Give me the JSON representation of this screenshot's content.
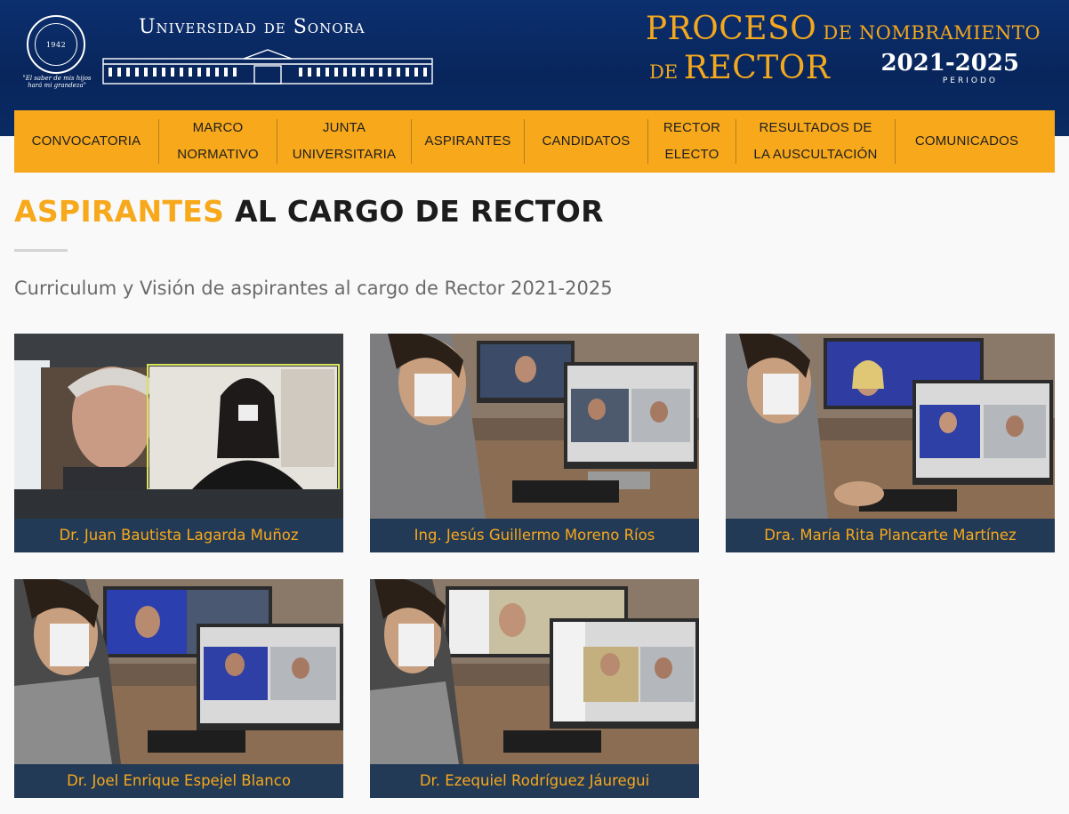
{
  "header": {
    "seal_text": "1942",
    "motto": "\"El saber de mis hijos hará mi grandeza\"",
    "university": "Universidad de Sonora",
    "title_line1_big": "PROCESO",
    "title_line1_small": " DE NOMBRAMIENTO",
    "title_line2_small": "DE ",
    "title_line2_big": "RECTOR",
    "years": "2021-2025",
    "periodo": "PERIODO"
  },
  "nav": {
    "items": [
      {
        "label_lines": [
          "CONVOCATORIA"
        ]
      },
      {
        "label_lines": [
          "MARCO",
          "NORMATIVO"
        ]
      },
      {
        "label_lines": [
          "JUNTA",
          "UNIVERSITARIA"
        ]
      },
      {
        "label_lines": [
          "ASPIRANTES"
        ]
      },
      {
        "label_lines": [
          "CANDIDATOS"
        ]
      },
      {
        "label_lines": [
          "RECTOR",
          "ELECTO"
        ]
      },
      {
        "label_lines": [
          "RESULTADOS DE",
          "LA AUSCULTACIÓN"
        ]
      },
      {
        "label_lines": [
          "COMUNICADOS"
        ]
      }
    ]
  },
  "page": {
    "title_accent": "ASPIRANTES",
    "title_rest": " AL CARGO DE RECTOR",
    "subtitle": "Curriculum y Visión de aspirantes al cargo de Rector 2021-2025"
  },
  "cards": [
    {
      "name": "Dr. Juan Bautista Lagarda Muñoz"
    },
    {
      "name": "Ing. Jesús Guillermo Moreno Ríos"
    },
    {
      "name": "Dra. María Rita Plancarte Martínez"
    },
    {
      "name": "Dr. Joel Enrique Espejel Blanco"
    },
    {
      "name": "Dr. Ezequiel Rodríguez Jáuregui"
    }
  ],
  "colors": {
    "header_bg": "#0c2f6e",
    "nav_bg": "#f7a81b",
    "accent": "#f7a81b",
    "caption_bg": "#233a56"
  }
}
